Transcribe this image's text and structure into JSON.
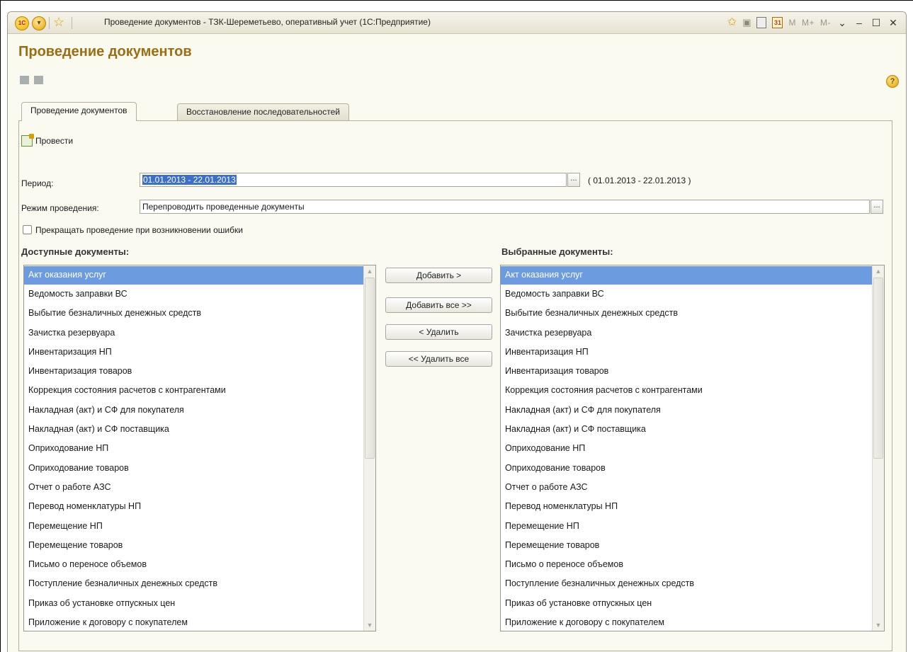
{
  "window": {
    "title": "Проведение документов - ТЗК-Шереметьево, оперативный учет  (1С:Предприятие)",
    "logo_text": "1С",
    "memory_buttons": [
      "M",
      "M+",
      "M-"
    ]
  },
  "form": {
    "title": "Проведение документов",
    "help": "?"
  },
  "tabs": [
    {
      "label": "Проведение документов",
      "active": true
    },
    {
      "label": "Восстановление последовательностей",
      "active": false
    }
  ],
  "toolbar": {
    "post_label": "Провести"
  },
  "period": {
    "label": "Период:",
    "value": "01.01.2013 - 22.01.2013",
    "picker_label": "...",
    "display": "( 01.01.2013 - 22.01.2013 )"
  },
  "mode": {
    "label": "Режим проведения:",
    "value": "Перепроводить проведенные документы",
    "picker_label": "..."
  },
  "stop_on_error": {
    "label": "Прекращать проведение при возникновении ошибки",
    "checked": false
  },
  "available": {
    "title": "Доступные документы:",
    "items": [
      "Акт оказания услуг",
      "Ведомость заправки ВС",
      "Выбытие безналичных денежных средств",
      "Зачистка резервуара",
      "Инвентаризация НП",
      "Инвентаризация товаров",
      "Коррекция состояния расчетов с контрагентами",
      "Накладная (акт) и СФ для покупателя",
      "Накладная (акт) и СФ поставщика",
      "Оприходование НП",
      "Оприходование товаров",
      "Отчет о работе АЗС",
      "Перевод номенклатуры НП",
      "Перемещение НП",
      "Перемещение товаров",
      "Письмо о переносе объемов",
      "Поступление безналичных денежных средств",
      "Приказ об установке отпускных цен",
      "Приложение к договору с покупателем"
    ],
    "selected_index": 0
  },
  "selected": {
    "title": "Выбранные документы:",
    "items": [
      "Акт оказания услуг",
      "Ведомость заправки ВС",
      "Выбытие безналичных денежных средств",
      "Зачистка резервуара",
      "Инвентаризация НП",
      "Инвентаризация товаров",
      "Коррекция состояния расчетов с контрагентами",
      "Накладная (акт) и СФ для покупателя",
      "Накладная (акт) и СФ поставщика",
      "Оприходование НП",
      "Оприходование товаров",
      "Отчет о работе АЗС",
      "Перевод номенклатуры НП",
      "Перемещение НП",
      "Перемещение товаров",
      "Письмо о переносе объемов",
      "Поступление безналичных денежных средств",
      "Приказ об установке отпускных цен",
      "Приложение к договору с покупателем"
    ],
    "selected_index": 0
  },
  "buttons": {
    "add": "Добавить >",
    "add_all": "Добавить все >>",
    "remove": "< Удалить",
    "remove_all": "<< Удалить все"
  },
  "colors": {
    "title_accent": "#9b6e12",
    "selection": "#6c9be0",
    "text_selection": "#3c6fc7"
  }
}
